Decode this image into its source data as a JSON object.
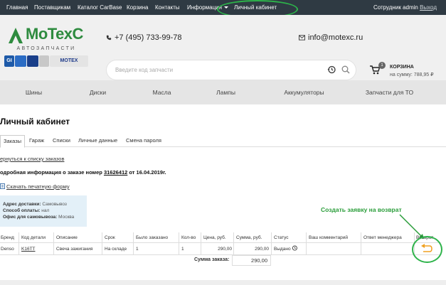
{
  "topnav": {
    "items": [
      "Главная",
      "Поставщикам",
      "Каталог CarBase",
      "Корзина",
      "Контакты",
      "Информация",
      "Личный кабинет"
    ],
    "user_label": "Сотрудник admin",
    "logout": "Выход"
  },
  "header": {
    "logo_text": "MoTexC",
    "logo_sub": "АВТОЗАПЧАСТИ",
    "brands": [
      "GI",
      "",
      "",
      "MOTEX"
    ],
    "phone": "+7 (495) 733-99-78",
    "email": "info@motexc.ru",
    "search_placeholder": "Введите код запчасти",
    "cart": {
      "count": "1",
      "title": "КОРЗИНА",
      "sum": "на сумму: 788,95 ₽"
    }
  },
  "categories": [
    "Шины",
    "Диски",
    "Масла",
    "Лампы",
    "Аккумуляторы",
    "Запчасти для ТО"
  ],
  "page": {
    "title": "Личный кабинет",
    "tabs": [
      "Заказы",
      "Гараж",
      "Списки",
      "Личные данные",
      "Смена пароля"
    ],
    "back_link": "ернуться к списку заказов",
    "order_prefix": "одробная информация о заказе номер ",
    "order_number": "31626412",
    "order_suffix": " от 16.04.2019г.",
    "print_link": "Скачать печатную форму",
    "delivery": {
      "address_label": "Адрес доставки:",
      "address_value": "Самовывоз",
      "payment_label": "Способ оплаты:",
      "payment_value": "нал",
      "office_label": "Офис для самовывоза:",
      "office_value": "Москва"
    },
    "annotation": "Создать заявку на возврат"
  },
  "table": {
    "headers": [
      "Бренд",
      "Код детали",
      "Описание",
      "Срок",
      "Было заказано",
      "Кол-во",
      "Цена, руб.",
      "Сумма, руб.",
      "Статус",
      "Ваш комментарий",
      "Ответ менеджера",
      "Возврат"
    ],
    "row": {
      "brand": "Denso",
      "code": "K16TT",
      "description": "Свеча зажигания",
      "term": "На складе",
      "ordered": "1",
      "qty": "1",
      "price": "290,00",
      "sum": "290,00",
      "status": "Выдано"
    },
    "total_label": "Сумма заказа:",
    "total_value": "290,00"
  },
  "colors": {
    "topnav_bg": "#2f3a43",
    "highlight_green": "#2db34a",
    "logo_green": "#2e8b3f",
    "return_icon": "#f0a020"
  }
}
